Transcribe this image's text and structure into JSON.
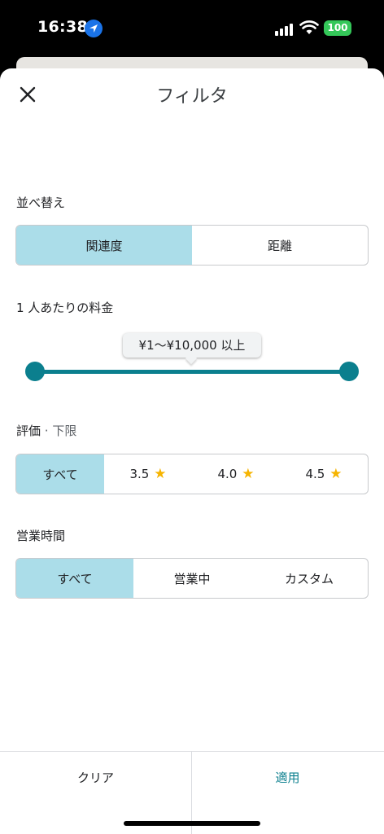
{
  "status_bar": {
    "time": "16:38",
    "battery": "100"
  },
  "header": {
    "title": "フィルタ"
  },
  "sort": {
    "label": "並べ替え",
    "options": [
      "関連度",
      "距離"
    ],
    "selected": "関連度"
  },
  "price": {
    "label": "1 人あたりの料金",
    "range_text": "¥1〜¥10,000 以上",
    "min_fraction": 0,
    "max_fraction": 1
  },
  "rating": {
    "label": "評価",
    "sub_label": " · 下限",
    "options": [
      "すべて",
      "3.5",
      "4.0",
      "4.5"
    ],
    "selected": "すべて"
  },
  "hours": {
    "label": "営業時間",
    "options": [
      "すべて",
      "営業中",
      "カスタム"
    ],
    "selected": "すべて"
  },
  "footer": {
    "clear": "クリア",
    "apply": "適用"
  },
  "colors": {
    "accent": "#0b7f8e",
    "selected_bg": "#abdde9",
    "star": "#f6b400"
  }
}
